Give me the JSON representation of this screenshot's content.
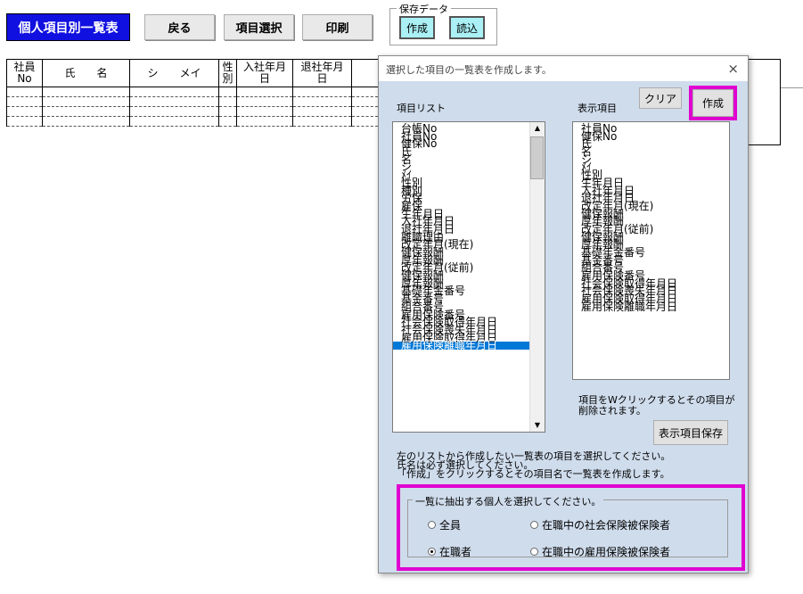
{
  "toolbar": {
    "title": "個人項目別一覧表",
    "back": "戻る",
    "select_items": "項目選択",
    "print": "印刷",
    "saved_data_legend": "保存データ",
    "create": "作成",
    "load": "読込"
  },
  "table": {
    "headers": [
      "社員\nNo",
      "氏　　名",
      "シ　　メイ",
      "性\n別",
      "入社年月\n日",
      "退社年月\n日"
    ]
  },
  "dialog": {
    "title": "選択した項目の一覧表を作成します。",
    "close": "×",
    "list_label": "項目リスト",
    "display_label": "表示項目",
    "clear_button": "クリア",
    "create_button": "作成",
    "item_list": [
      "台帳No",
      "社員No",
      "健保No",
      "氏",
      "名",
      "シ",
      "ﾒｲ",
      "性別",
      "種別",
      "労保",
      "雇保",
      "生年月日",
      "入社年月日",
      "退社年月日",
      "離職理由",
      "改定年月(現在)",
      "健保報酬",
      "厚年報酬",
      "改定年月(従前)",
      "健保報酬",
      "厚年報酬",
      "基礎年金番号",
      "基金番号",
      "組合番号",
      "雇用保険番号",
      "社会保険取得年月日",
      "社会保険喪失年月日",
      "雇用保険取得年月日",
      "雇用保険離職年月日"
    ],
    "display_items": [
      "社員No",
      "健保No",
      "氏",
      "名",
      "シ",
      "ﾒｲ",
      "性別",
      "生年月日",
      "入社年月日",
      "退社年月日",
      "改定年月(現在)",
      "健保報酬",
      "厚年報酬",
      "改定年月(従前)",
      "健保報酬",
      "厚年報酬",
      "基礎年金番号",
      "基金番号",
      "組合番号",
      "雇用保険番号",
      "社会保険取得年月日",
      "社会保険喪失年月日",
      "雇用保険取得年月日",
      "雇用保険離職年月日"
    ],
    "hint": "項目をWクリックするとその項目が\n削除されます。",
    "save_display_button": "表示項目保存",
    "instructions": "左のリストから作成したい一覧表の項目を選択してください。\n氏名は必ず選択してください。\n「作成」をクリックするとその項目名で一覧表を作成します。",
    "group_label": "一覧に抽出する個人を選択してください。",
    "options": {
      "all": "全員",
      "employed": "在職者",
      "social_insured": "在職中の社会保険被保険者",
      "employment_insured": "在職中の雇用保険被保険者"
    },
    "selected_option": "employed"
  }
}
